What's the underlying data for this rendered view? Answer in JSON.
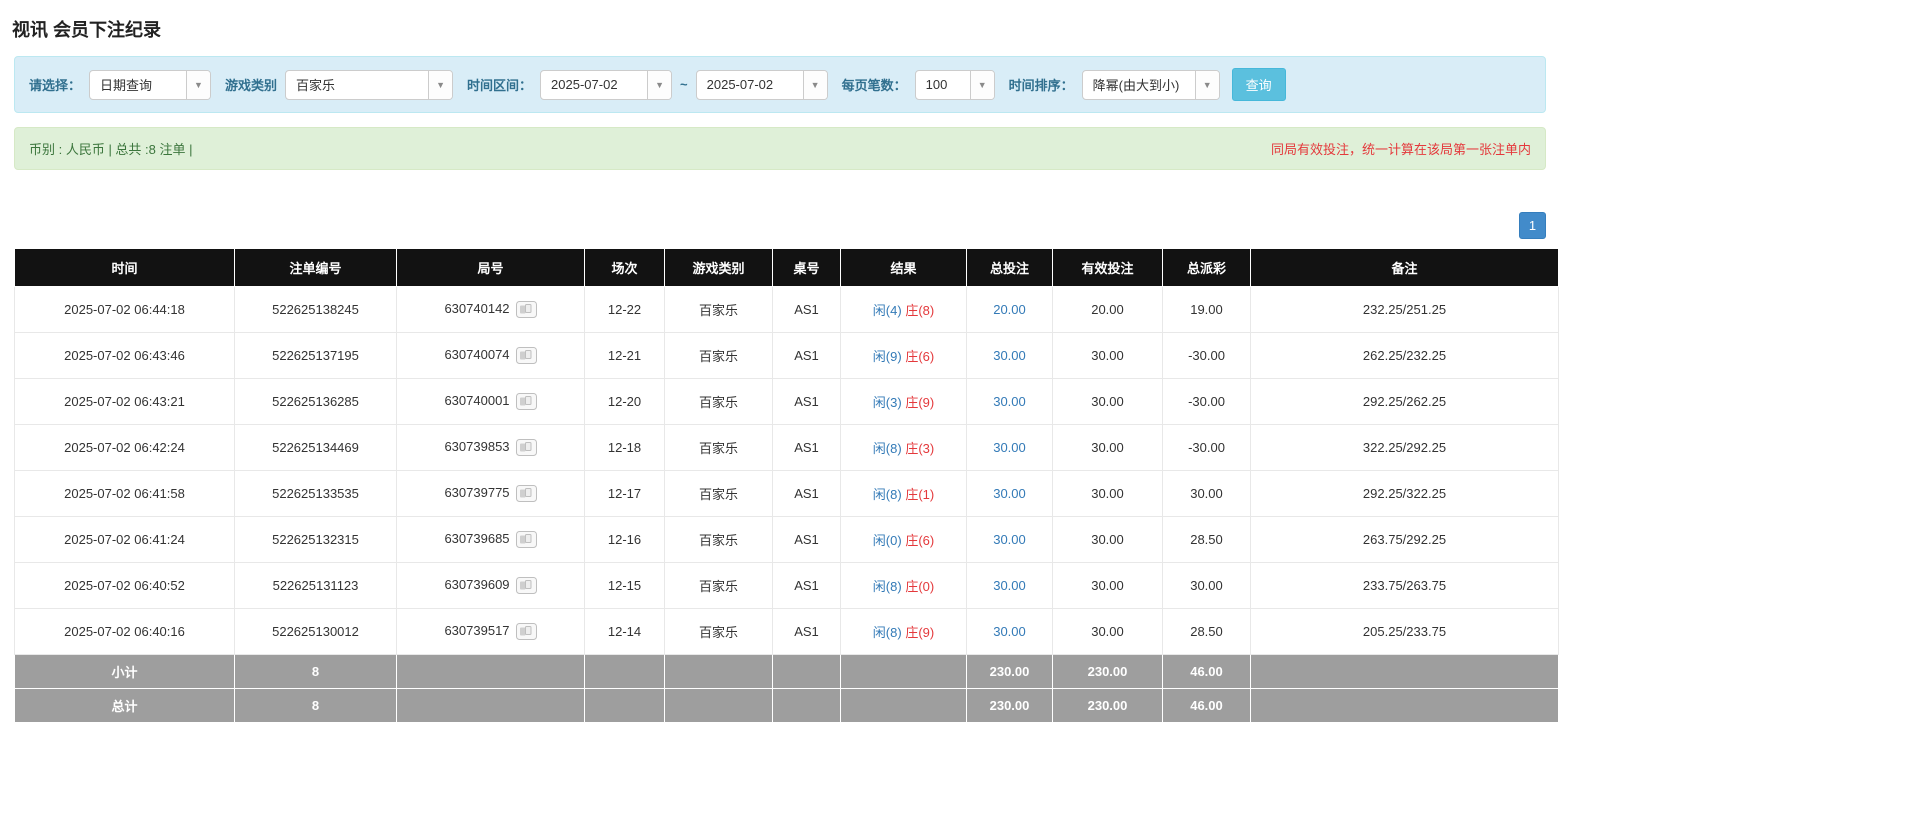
{
  "page": {
    "title": "视讯 会员下注纪录"
  },
  "filters": {
    "select_label": "请选择：",
    "select_value": "日期查询",
    "game_label": "游戏类别",
    "game_value": "百家乐",
    "range_label": "时间区间：",
    "date_from": "2025-07-02",
    "range_separator": "~",
    "date_to": "2025-07-02",
    "page_size_label": "每页笔数：",
    "page_size_value": "100",
    "sort_label": "时间排序：",
    "sort_value": "降幂(由大到小)",
    "search_button": "查询"
  },
  "summary": {
    "left": "币别 : 人民币 | 总共 :8 注单 |",
    "right": "同局有效投注，统一计算在该局第一张注单内"
  },
  "pagination": {
    "current": "1"
  },
  "table": {
    "columns": [
      "时间",
      "注单编号",
      "局号",
      "场次",
      "游戏类别",
      "桌号",
      "结果",
      "总投注",
      "有效投注",
      "总派彩",
      "备注"
    ],
    "rows": [
      {
        "time": "2025-07-02 06:44:18",
        "bet_id": "522625138245",
        "round": "630740142",
        "session": "12-22",
        "game": "百家乐",
        "table_no": "AS1",
        "result_player": "闲(4)",
        "result_banker": "庄(8)",
        "total_bet": "20.00",
        "valid_bet": "20.00",
        "payout": "19.00",
        "note": "232.25/251.25"
      },
      {
        "time": "2025-07-02 06:43:46",
        "bet_id": "522625137195",
        "round": "630740074",
        "session": "12-21",
        "game": "百家乐",
        "table_no": "AS1",
        "result_player": "闲(9)",
        "result_banker": "庄(6)",
        "total_bet": "30.00",
        "valid_bet": "30.00",
        "payout": "-30.00",
        "note": "262.25/232.25"
      },
      {
        "time": "2025-07-02 06:43:21",
        "bet_id": "522625136285",
        "round": "630740001",
        "session": "12-20",
        "game": "百家乐",
        "table_no": "AS1",
        "result_player": "闲(3)",
        "result_banker": "庄(9)",
        "total_bet": "30.00",
        "valid_bet": "30.00",
        "payout": "-30.00",
        "note": "292.25/262.25"
      },
      {
        "time": "2025-07-02 06:42:24",
        "bet_id": "522625134469",
        "round": "630739853",
        "session": "12-18",
        "game": "百家乐",
        "table_no": "AS1",
        "result_player": "闲(8)",
        "result_banker": "庄(3)",
        "total_bet": "30.00",
        "valid_bet": "30.00",
        "payout": "-30.00",
        "note": "322.25/292.25"
      },
      {
        "time": "2025-07-02 06:41:58",
        "bet_id": "522625133535",
        "round": "630739775",
        "session": "12-17",
        "game": "百家乐",
        "table_no": "AS1",
        "result_player": "闲(8)",
        "result_banker": "庄(1)",
        "total_bet": "30.00",
        "valid_bet": "30.00",
        "payout": "30.00",
        "note": "292.25/322.25"
      },
      {
        "time": "2025-07-02 06:41:24",
        "bet_id": "522625132315",
        "round": "630739685",
        "session": "12-16",
        "game": "百家乐",
        "table_no": "AS1",
        "result_player": "闲(0)",
        "result_banker": "庄(6)",
        "total_bet": "30.00",
        "valid_bet": "30.00",
        "payout": "28.50",
        "note": "263.75/292.25"
      },
      {
        "time": "2025-07-02 06:40:52",
        "bet_id": "522625131123",
        "round": "630739609",
        "session": "12-15",
        "game": "百家乐",
        "table_no": "AS1",
        "result_player": "闲(8)",
        "result_banker": "庄(0)",
        "total_bet": "30.00",
        "valid_bet": "30.00",
        "payout": "30.00",
        "note": "233.75/263.75"
      },
      {
        "time": "2025-07-02 06:40:16",
        "bet_id": "522625130012",
        "round": "630739517",
        "session": "12-14",
        "game": "百家乐",
        "table_no": "AS1",
        "result_player": "闲(8)",
        "result_banker": "庄(9)",
        "total_bet": "30.00",
        "valid_bet": "30.00",
        "payout": "28.50",
        "note": "205.25/233.75"
      }
    ],
    "footer": [
      {
        "label": "小计",
        "count": "8",
        "total_bet": "230.00",
        "valid_bet": "230.00",
        "payout": "46.00"
      },
      {
        "label": "总计",
        "count": "8",
        "total_bet": "230.00",
        "valid_bet": "230.00",
        "payout": "46.00"
      }
    ]
  },
  "colors": {
    "accent_blue": "#428bca",
    "link_blue": "#337ab7",
    "player_blue": "#337ab7",
    "banker_red": "#e4393c",
    "negative_red": "#e4393c",
    "header_bg": "#121212",
    "footer_bg": "#9e9e9e",
    "filter_bg": "#d9edf7",
    "summary_bg": "#dff0d8",
    "search_button_blue": "#5bc0de"
  }
}
